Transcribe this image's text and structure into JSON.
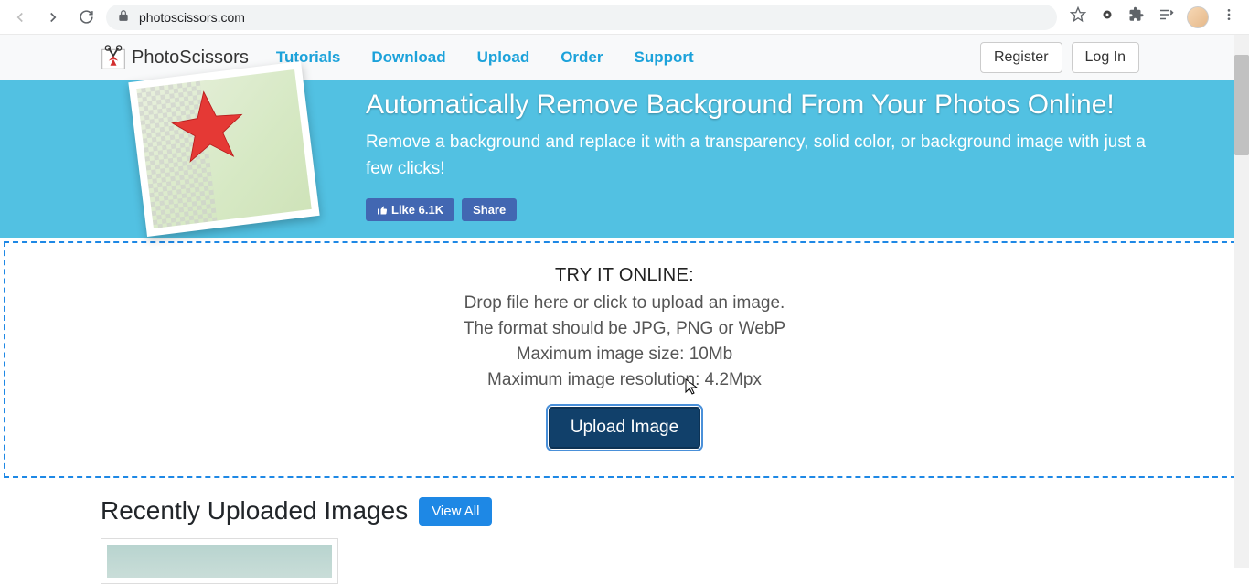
{
  "browser": {
    "url": "photoscissors.com"
  },
  "navbar": {
    "brand": "PhotoScissors",
    "links": [
      "Tutorials",
      "Download",
      "Upload",
      "Order",
      "Support"
    ],
    "register": "Register",
    "login": "Log In"
  },
  "hero": {
    "title": "Automatically Remove Background From Your Photos Online!",
    "subtitle": "Remove a background and replace it with a transparency, solid color, or background image with just a few clicks!",
    "like_label": "Like 6.1K",
    "share_label": "Share"
  },
  "dropzone": {
    "title": "TRY IT ONLINE:",
    "line1": "Drop file here or click to upload an image.",
    "line2": "The format should be JPG, PNG or WebP",
    "line3": "Maximum image size: 10Mb",
    "line4": "Maximum image resolution: 4.2Mpx",
    "button": "Upload Image"
  },
  "recent": {
    "heading": "Recently Uploaded Images",
    "view_all": "View All"
  }
}
